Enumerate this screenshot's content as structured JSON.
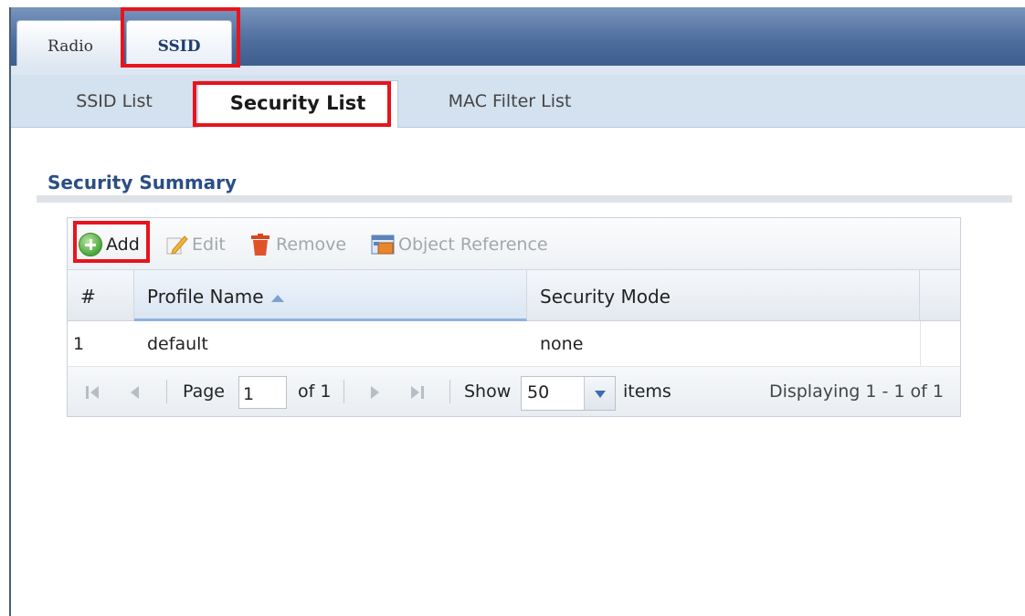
{
  "main_tabs": [
    {
      "label": "Radio",
      "active": false
    },
    {
      "label": "SSID",
      "active": true
    }
  ],
  "sub_tabs": [
    {
      "label": "SSID List",
      "active": false
    },
    {
      "label": "Security List",
      "active": true
    },
    {
      "label": "MAC Filter List",
      "active": false
    }
  ],
  "section": {
    "title": "Security Summary"
  },
  "toolbar": {
    "add_label": "Add",
    "edit_label": "Edit",
    "remove_label": "Remove",
    "reference_label": "Object Reference",
    "icons": {
      "add": "add-circle-icon",
      "edit": "edit-pencil-icon",
      "remove": "trash-icon",
      "reference": "object-reference-icon"
    }
  },
  "table": {
    "columns": [
      "#",
      "Profile Name",
      "Security Mode"
    ],
    "sort": {
      "column": "Profile Name",
      "direction": "ascending"
    },
    "rows": [
      {
        "num": "1",
        "profile_name": "default",
        "security_mode": "none"
      }
    ]
  },
  "pager": {
    "page_label": "Page",
    "page_value": "1",
    "of_label": "of 1",
    "show_label": "Show",
    "page_size": "50",
    "items_label": "items",
    "displaying": "Displaying 1 - 1 of 1"
  },
  "colors": {
    "accent_blue": "#2b4e85",
    "highlight_red": "#e8141c",
    "tabbar_blue": "#4f6f9e"
  }
}
